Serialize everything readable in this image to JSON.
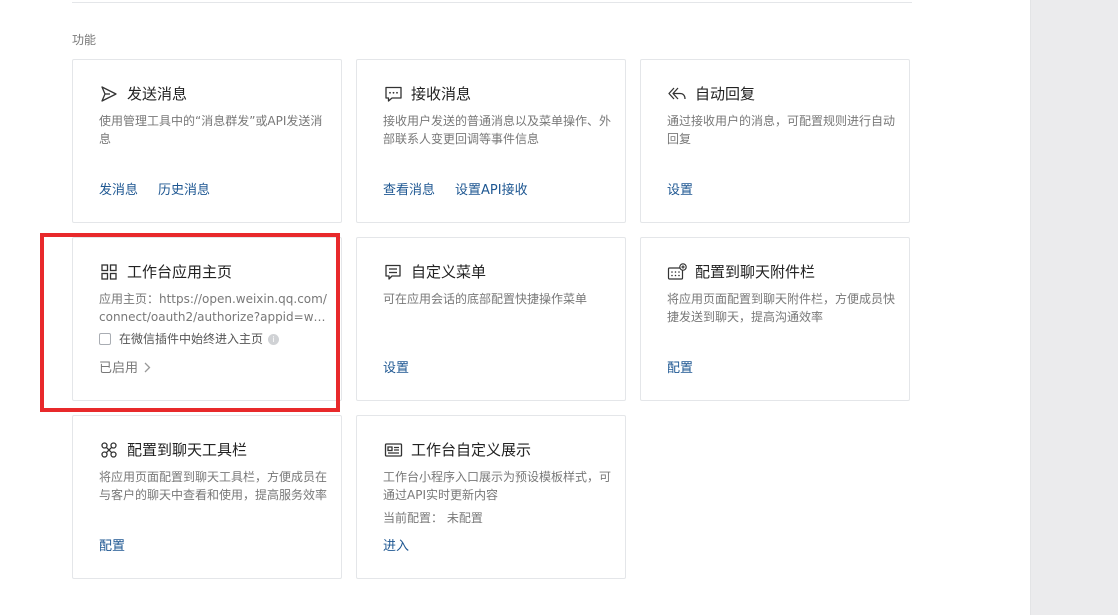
{
  "section_label": "功能",
  "cards": [
    {
      "title": "发送消息",
      "icon": "send-icon",
      "description": "使用管理工具中的“消息群发”或API发送消息",
      "actions": [
        "发消息",
        "历史消息"
      ]
    },
    {
      "title": "接收消息",
      "icon": "chat-bubble-icon",
      "description": "接收用户发送的普通消息以及菜单操作、外部联系人变更回调等事件信息",
      "actions": [
        "查看消息",
        "设置API接收"
      ]
    },
    {
      "title": "自动回复",
      "icon": "reply-icon",
      "description": "通过接收用户的消息，可配置规则进行自动回复",
      "actions": [
        "设置"
      ]
    },
    {
      "title": "工作台应用主页",
      "icon": "grid-icon",
      "description": "应用主页：https://open.weixin.qq.com/connect/oauth2/authorize?appid=ww6ba...",
      "checkbox_label": "在微信插件中始终进入主页",
      "checkbox_checked": false,
      "status": "已启用"
    },
    {
      "title": "自定义菜单",
      "icon": "menu-icon",
      "description": "可在应用会话的底部配置快捷操作菜单",
      "actions": [
        "设置"
      ]
    },
    {
      "title": "配置到聊天附件栏",
      "icon": "attachment-bar-icon",
      "description": "将应用页面配置到聊天附件栏，方便成员快捷发送到聊天，提高沟通效率",
      "actions": [
        "配置"
      ]
    },
    {
      "title": "配置到聊天工具栏",
      "icon": "toolbar-icon",
      "description": "将应用页面配置到聊天工具栏，方便成员在与客户的聊天中查看和使用，提高服务效率",
      "actions": [
        "配置"
      ]
    },
    {
      "title": "工作台自定义展示",
      "icon": "display-card-icon",
      "description": "工作台小程序入口展示为预设模板样式，可通过API实时更新内容",
      "extra": "当前配置： 未配置",
      "actions": [
        "进入"
      ]
    }
  ],
  "colors": {
    "link": "#1e5792",
    "highlight": "#e8292b",
    "muted_text": "#787878",
    "border": "#e4e6e9"
  }
}
